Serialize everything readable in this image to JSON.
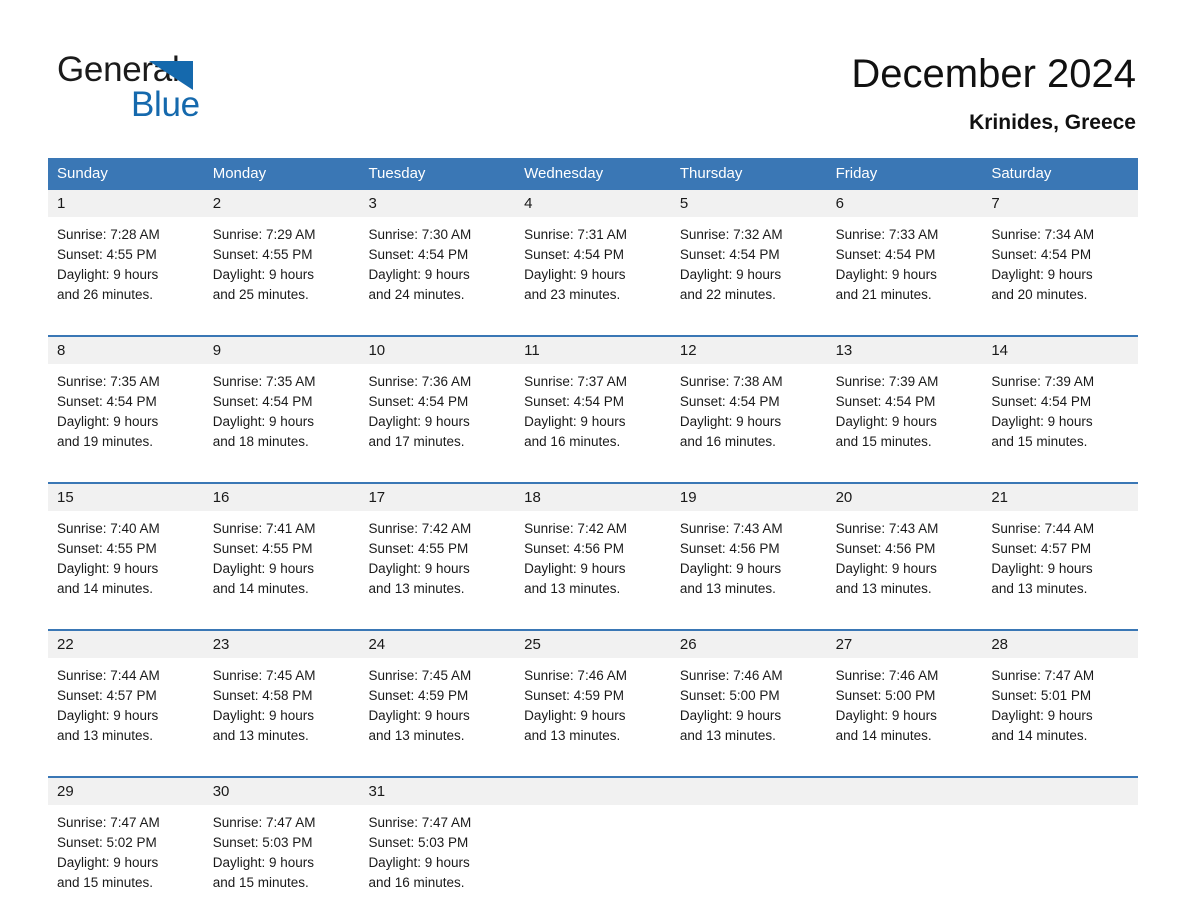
{
  "logo": {
    "word1": "General",
    "word2": "Blue",
    "triangle_color": "#1569ad",
    "text_color": "#1b1b1b"
  },
  "header": {
    "title": "December 2024",
    "location": "Krinides, Greece"
  },
  "theme": {
    "header_blue": "#3a77b5",
    "day_band_gray": "#f1f1f1",
    "text": "#1a1a1a"
  },
  "weekdays": [
    "Sunday",
    "Monday",
    "Tuesday",
    "Wednesday",
    "Thursday",
    "Friday",
    "Saturday"
  ],
  "weeks": [
    [
      {
        "day": "1",
        "sunrise": "Sunrise: 7:28 AM",
        "sunset": "Sunset: 4:55 PM",
        "daylight1": "Daylight: 9 hours",
        "daylight2": "and 26 minutes."
      },
      {
        "day": "2",
        "sunrise": "Sunrise: 7:29 AM",
        "sunset": "Sunset: 4:55 PM",
        "daylight1": "Daylight: 9 hours",
        "daylight2": "and 25 minutes."
      },
      {
        "day": "3",
        "sunrise": "Sunrise: 7:30 AM",
        "sunset": "Sunset: 4:54 PM",
        "daylight1": "Daylight: 9 hours",
        "daylight2": "and 24 minutes."
      },
      {
        "day": "4",
        "sunrise": "Sunrise: 7:31 AM",
        "sunset": "Sunset: 4:54 PM",
        "daylight1": "Daylight: 9 hours",
        "daylight2": "and 23 minutes."
      },
      {
        "day": "5",
        "sunrise": "Sunrise: 7:32 AM",
        "sunset": "Sunset: 4:54 PM",
        "daylight1": "Daylight: 9 hours",
        "daylight2": "and 22 minutes."
      },
      {
        "day": "6",
        "sunrise": "Sunrise: 7:33 AM",
        "sunset": "Sunset: 4:54 PM",
        "daylight1": "Daylight: 9 hours",
        "daylight2": "and 21 minutes."
      },
      {
        "day": "7",
        "sunrise": "Sunrise: 7:34 AM",
        "sunset": "Sunset: 4:54 PM",
        "daylight1": "Daylight: 9 hours",
        "daylight2": "and 20 minutes."
      }
    ],
    [
      {
        "day": "8",
        "sunrise": "Sunrise: 7:35 AM",
        "sunset": "Sunset: 4:54 PM",
        "daylight1": "Daylight: 9 hours",
        "daylight2": "and 19 minutes."
      },
      {
        "day": "9",
        "sunrise": "Sunrise: 7:35 AM",
        "sunset": "Sunset: 4:54 PM",
        "daylight1": "Daylight: 9 hours",
        "daylight2": "and 18 minutes."
      },
      {
        "day": "10",
        "sunrise": "Sunrise: 7:36 AM",
        "sunset": "Sunset: 4:54 PM",
        "daylight1": "Daylight: 9 hours",
        "daylight2": "and 17 minutes."
      },
      {
        "day": "11",
        "sunrise": "Sunrise: 7:37 AM",
        "sunset": "Sunset: 4:54 PM",
        "daylight1": "Daylight: 9 hours",
        "daylight2": "and 16 minutes."
      },
      {
        "day": "12",
        "sunrise": "Sunrise: 7:38 AM",
        "sunset": "Sunset: 4:54 PM",
        "daylight1": "Daylight: 9 hours",
        "daylight2": "and 16 minutes."
      },
      {
        "day": "13",
        "sunrise": "Sunrise: 7:39 AM",
        "sunset": "Sunset: 4:54 PM",
        "daylight1": "Daylight: 9 hours",
        "daylight2": "and 15 minutes."
      },
      {
        "day": "14",
        "sunrise": "Sunrise: 7:39 AM",
        "sunset": "Sunset: 4:54 PM",
        "daylight1": "Daylight: 9 hours",
        "daylight2": "and 15 minutes."
      }
    ],
    [
      {
        "day": "15",
        "sunrise": "Sunrise: 7:40 AM",
        "sunset": "Sunset: 4:55 PM",
        "daylight1": "Daylight: 9 hours",
        "daylight2": "and 14 minutes."
      },
      {
        "day": "16",
        "sunrise": "Sunrise: 7:41 AM",
        "sunset": "Sunset: 4:55 PM",
        "daylight1": "Daylight: 9 hours",
        "daylight2": "and 14 minutes."
      },
      {
        "day": "17",
        "sunrise": "Sunrise: 7:42 AM",
        "sunset": "Sunset: 4:55 PM",
        "daylight1": "Daylight: 9 hours",
        "daylight2": "and 13 minutes."
      },
      {
        "day": "18",
        "sunrise": "Sunrise: 7:42 AM",
        "sunset": "Sunset: 4:56 PM",
        "daylight1": "Daylight: 9 hours",
        "daylight2": "and 13 minutes."
      },
      {
        "day": "19",
        "sunrise": "Sunrise: 7:43 AM",
        "sunset": "Sunset: 4:56 PM",
        "daylight1": "Daylight: 9 hours",
        "daylight2": "and 13 minutes."
      },
      {
        "day": "20",
        "sunrise": "Sunrise: 7:43 AM",
        "sunset": "Sunset: 4:56 PM",
        "daylight1": "Daylight: 9 hours",
        "daylight2": "and 13 minutes."
      },
      {
        "day": "21",
        "sunrise": "Sunrise: 7:44 AM",
        "sunset": "Sunset: 4:57 PM",
        "daylight1": "Daylight: 9 hours",
        "daylight2": "and 13 minutes."
      }
    ],
    [
      {
        "day": "22",
        "sunrise": "Sunrise: 7:44 AM",
        "sunset": "Sunset: 4:57 PM",
        "daylight1": "Daylight: 9 hours",
        "daylight2": "and 13 minutes."
      },
      {
        "day": "23",
        "sunrise": "Sunrise: 7:45 AM",
        "sunset": "Sunset: 4:58 PM",
        "daylight1": "Daylight: 9 hours",
        "daylight2": "and 13 minutes."
      },
      {
        "day": "24",
        "sunrise": "Sunrise: 7:45 AM",
        "sunset": "Sunset: 4:59 PM",
        "daylight1": "Daylight: 9 hours",
        "daylight2": "and 13 minutes."
      },
      {
        "day": "25",
        "sunrise": "Sunrise: 7:46 AM",
        "sunset": "Sunset: 4:59 PM",
        "daylight1": "Daylight: 9 hours",
        "daylight2": "and 13 minutes."
      },
      {
        "day": "26",
        "sunrise": "Sunrise: 7:46 AM",
        "sunset": "Sunset: 5:00 PM",
        "daylight1": "Daylight: 9 hours",
        "daylight2": "and 13 minutes."
      },
      {
        "day": "27",
        "sunrise": "Sunrise: 7:46 AM",
        "sunset": "Sunset: 5:00 PM",
        "daylight1": "Daylight: 9 hours",
        "daylight2": "and 14 minutes."
      },
      {
        "day": "28",
        "sunrise": "Sunrise: 7:47 AM",
        "sunset": "Sunset: 5:01 PM",
        "daylight1": "Daylight: 9 hours",
        "daylight2": "and 14 minutes."
      }
    ],
    [
      {
        "day": "29",
        "sunrise": "Sunrise: 7:47 AM",
        "sunset": "Sunset: 5:02 PM",
        "daylight1": "Daylight: 9 hours",
        "daylight2": "and 15 minutes."
      },
      {
        "day": "30",
        "sunrise": "Sunrise: 7:47 AM",
        "sunset": "Sunset: 5:03 PM",
        "daylight1": "Daylight: 9 hours",
        "daylight2": "and 15 minutes."
      },
      {
        "day": "31",
        "sunrise": "Sunrise: 7:47 AM",
        "sunset": "Sunset: 5:03 PM",
        "daylight1": "Daylight: 9 hours",
        "daylight2": "and 16 minutes."
      },
      {
        "day": "",
        "sunrise": "",
        "sunset": "",
        "daylight1": "",
        "daylight2": ""
      },
      {
        "day": "",
        "sunrise": "",
        "sunset": "",
        "daylight1": "",
        "daylight2": ""
      },
      {
        "day": "",
        "sunrise": "",
        "sunset": "",
        "daylight1": "",
        "daylight2": ""
      },
      {
        "day": "",
        "sunrise": "",
        "sunset": "",
        "daylight1": "",
        "daylight2": ""
      }
    ]
  ]
}
